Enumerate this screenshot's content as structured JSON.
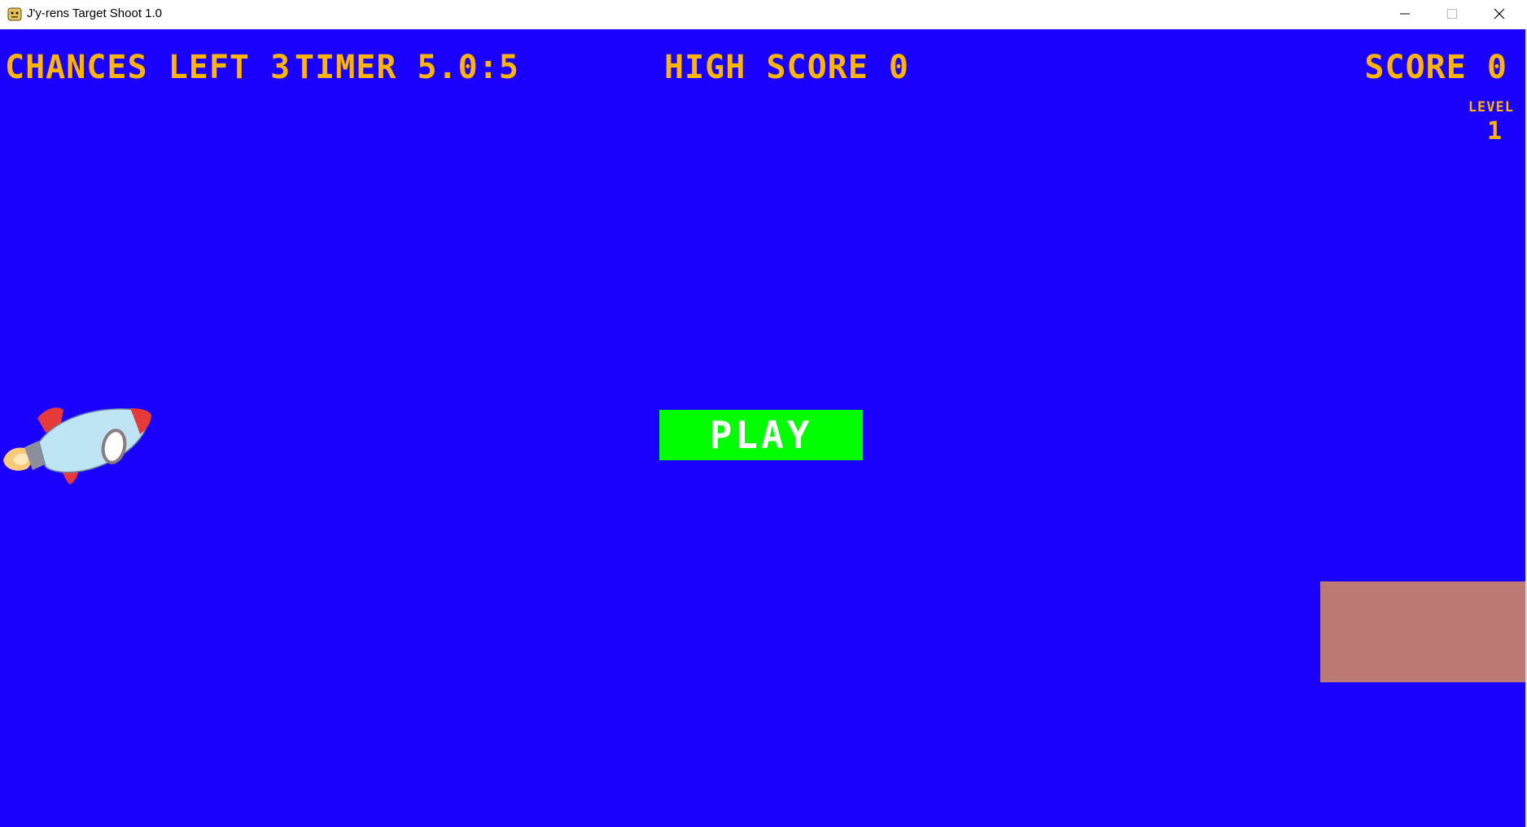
{
  "window": {
    "title": "J'y-rens Target Shoot 1.0"
  },
  "hud": {
    "chances_left": "CHANCES LEFT 3",
    "timer": "TIMER 5.0:5",
    "high_score": "HIGH SCORE 0",
    "score": "SCORE 0",
    "level_label": "LEVEL",
    "level_value": "1"
  },
  "play_button": {
    "label": "PLAY"
  },
  "colors": {
    "background": "#1a00ff",
    "hud_text": "#ffb400",
    "play_button": "#00ff00",
    "target": "#bd7a74"
  },
  "icons": {
    "app": "pygame-snake-icon",
    "player": "rocket-icon"
  }
}
